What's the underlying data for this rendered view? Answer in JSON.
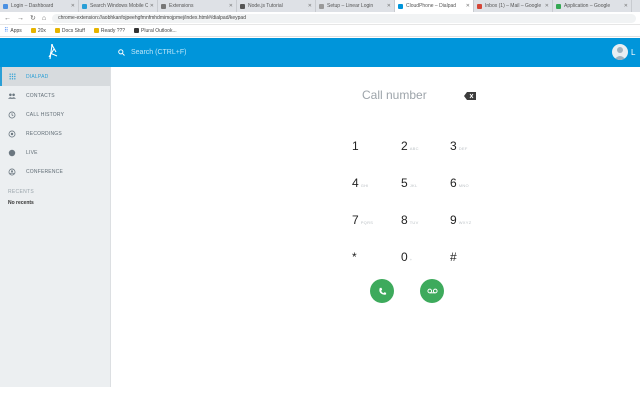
{
  "browser": {
    "tabs": [
      {
        "label": "Login – Dashboard",
        "favicon_color": "#4a90e2",
        "active": false
      },
      {
        "label": "Search Windows Mobile Ca",
        "favicon_color": "#2a9fd6",
        "active": false
      },
      {
        "label": "Extensions",
        "favicon_color": "#777777",
        "active": false
      },
      {
        "label": "Node.js Tutorial",
        "favicon_color": "#555555",
        "active": false
      },
      {
        "label": "Setup – Linear Login",
        "favicon_color": "#999999",
        "active": false
      },
      {
        "label": "CloudPhone – Dialpad",
        "favicon_color": "#0095da",
        "active": true
      },
      {
        "label": "Inbox (1) – Mail – Google",
        "favicon_color": "#d44638",
        "active": false
      },
      {
        "label": "Application – Google",
        "favicon_color": "#34a853",
        "active": false
      }
    ],
    "url": "chrome-extension://aobhkanfojpeehgfmnfmhdmimojpmej/index.html#/dialpad/keypad",
    "bookmarks": [
      {
        "label": "Apps"
      },
      {
        "label": "20x"
      },
      {
        "label": "Docs Stuff"
      },
      {
        "label": "Ready ???"
      },
      {
        "label": "Plural Outlook..."
      }
    ]
  },
  "header": {
    "search_placeholder": "Search (CTRL+F)",
    "avatar_letter": "L"
  },
  "sidebar": {
    "items": [
      {
        "label": "DIALPAD",
        "icon": "dialpad-icon",
        "active": true
      },
      {
        "label": "CONTACTS",
        "icon": "contacts-icon",
        "active": false
      },
      {
        "label": "CALL HISTORY",
        "icon": "history-icon",
        "active": false
      },
      {
        "label": "RECORDINGS",
        "icon": "recordings-icon",
        "active": false
      },
      {
        "label": "LIVE",
        "icon": "live-icon",
        "active": false
      },
      {
        "label": "CONFERENCE",
        "icon": "conference-icon",
        "active": false
      }
    ],
    "recents_title": "RECENTS",
    "no_recents": "No recents"
  },
  "dialpad": {
    "placeholder": "Call number",
    "keys": [
      {
        "digit": "1",
        "letters": ""
      },
      {
        "digit": "2",
        "letters": "ABC"
      },
      {
        "digit": "3",
        "letters": "DEF"
      },
      {
        "digit": "4",
        "letters": "GHI"
      },
      {
        "digit": "5",
        "letters": "JKL"
      },
      {
        "digit": "6",
        "letters": "MNO"
      },
      {
        "digit": "7",
        "letters": "PQRS"
      },
      {
        "digit": "8",
        "letters": "TUV"
      },
      {
        "digit": "9",
        "letters": "WXYZ"
      },
      {
        "digit": "*",
        "letters": ""
      },
      {
        "digit": "0",
        "letters": "+"
      },
      {
        "digit": "#",
        "letters": ""
      }
    ],
    "call_button_icon": "phone-icon",
    "voicemail_button_icon": "voicemail-icon",
    "action_color": "#3daa5c"
  },
  "colors": {
    "brand": "#0095da",
    "active": "#2a9fd6"
  }
}
